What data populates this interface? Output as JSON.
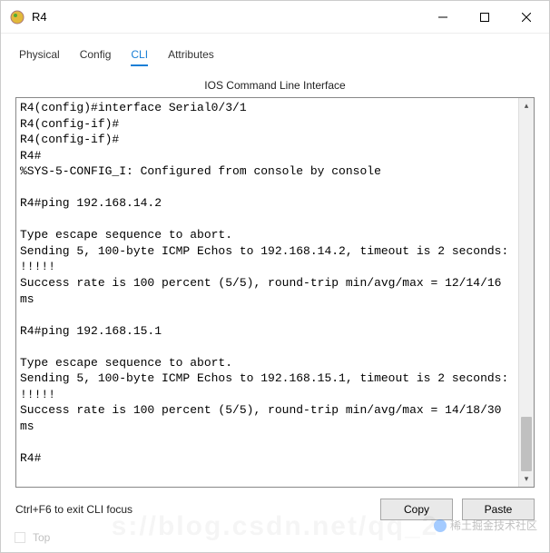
{
  "window": {
    "title": "R4"
  },
  "tabs": {
    "physical": "Physical",
    "config": "Config",
    "cli": "CLI",
    "attributes": "Attributes"
  },
  "panel": {
    "title": "IOS Command Line Interface"
  },
  "terminal": {
    "text": "R4(config)#interface Serial0/3/1\nR4(config-if)#\nR4(config-if)#\nR4#\n%SYS-5-CONFIG_I: Configured from console by console\n\nR4#ping 192.168.14.2\n\nType escape sequence to abort.\nSending 5, 100-byte ICMP Echos to 192.168.14.2, timeout is 2 seconds:\n!!!!!\nSuccess rate is 100 percent (5/5), round-trip min/avg/max = 12/14/16 ms\n\nR4#ping 192.168.15.1\n\nType escape sequence to abort.\nSending 5, 100-byte ICMP Echos to 192.168.15.1, timeout is 2 seconds:\n!!!!!\nSuccess rate is 100 percent (5/5), round-trip min/avg/max = 14/18/30 ms\n\nR4#"
  },
  "hint": "Ctrl+F6 to exit CLI focus",
  "buttons": {
    "copy": "Copy",
    "paste": "Paste"
  },
  "footer": {
    "label": "Top"
  },
  "watermark": "稀土掘金技术社区"
}
